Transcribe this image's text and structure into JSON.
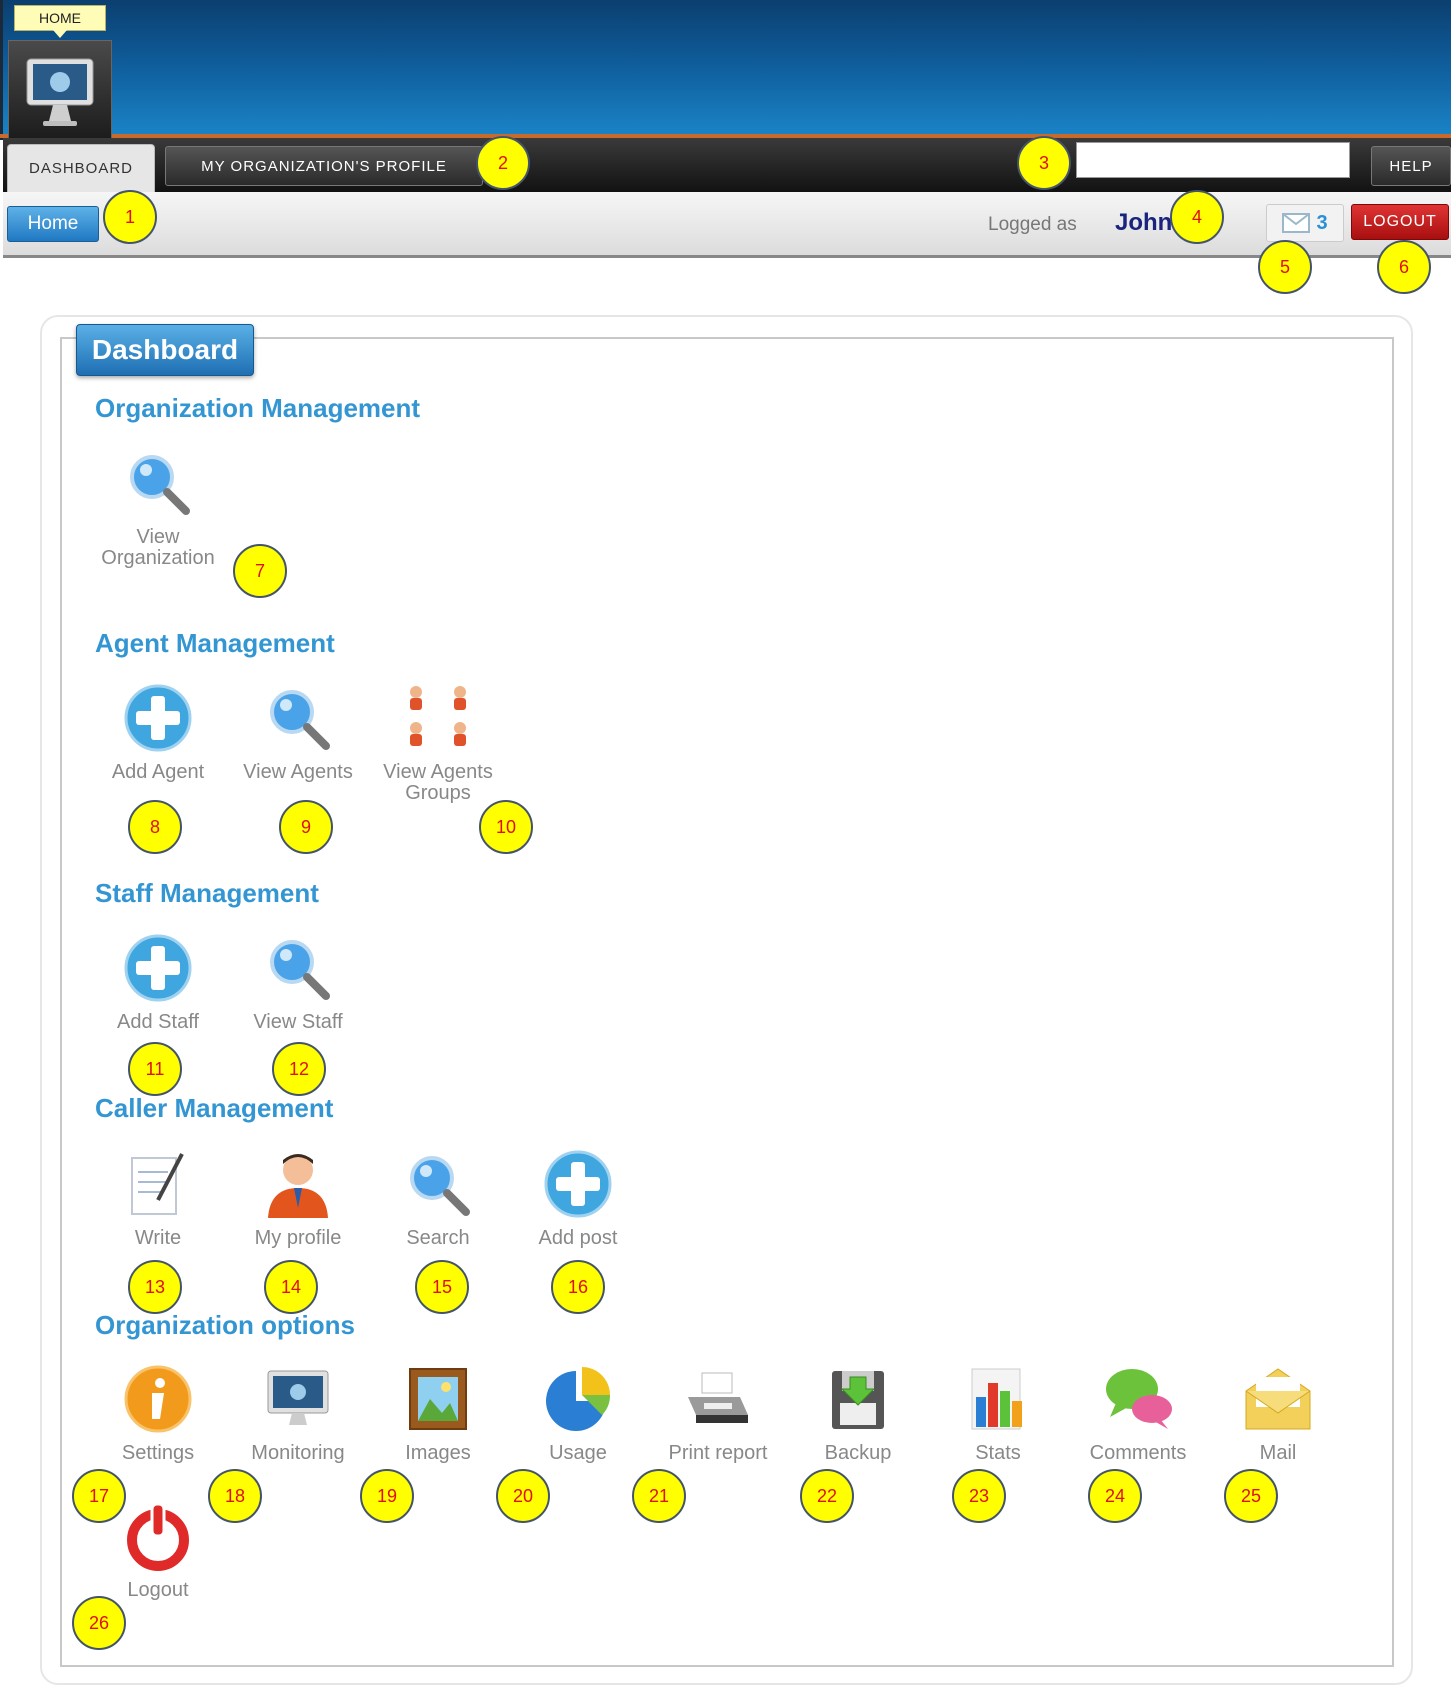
{
  "header": {
    "home_tooltip": "HOME"
  },
  "nav": {
    "dashboard_tab": "DASHBOARD",
    "profile_tab": "MY ORGANIZATION'S PROFILE",
    "search_value": "",
    "help_button": "HELP"
  },
  "subbar": {
    "home_button": "Home",
    "logged_as_label": "Logged as",
    "user_name": "John",
    "mail_count": "3",
    "logout_button": "LOGOUT"
  },
  "dashboard": {
    "title": "Dashboard",
    "sections": {
      "organization": {
        "title": "Organization Management",
        "items": [
          {
            "label_line1": "View",
            "label_line2": "Organization",
            "icon": "magnifier-icon"
          }
        ]
      },
      "agent": {
        "title": "Agent Management",
        "items": [
          {
            "label": "Add Agent",
            "icon": "add-plus-icon"
          },
          {
            "label": "View Agents",
            "icon": "magnifier-icon"
          },
          {
            "label_line1": "View Agents",
            "label_line2": "Groups",
            "icon": "user-group-icon"
          }
        ]
      },
      "staff": {
        "title": "Staff Management",
        "items": [
          {
            "label": "Add Staff",
            "icon": "add-plus-icon"
          },
          {
            "label": "View Staff",
            "icon": "magnifier-icon"
          }
        ]
      },
      "caller": {
        "title": "Caller Management",
        "items": [
          {
            "label": "Write",
            "icon": "pen-paper-icon"
          },
          {
            "label": "My profile",
            "icon": "person-icon"
          },
          {
            "label": "Search",
            "icon": "magnifier-icon"
          },
          {
            "label": "Add post",
            "icon": "add-plus-icon"
          }
        ]
      },
      "options": {
        "title": "Organization options",
        "items": [
          {
            "label": "Settings",
            "icon": "info-icon"
          },
          {
            "label": "Monitoring",
            "icon": "monitor-icon"
          },
          {
            "label": "Images",
            "icon": "picture-frame-icon"
          },
          {
            "label": "Usage",
            "icon": "pie-chart-icon"
          },
          {
            "label": "Print report",
            "icon": "printer-icon"
          },
          {
            "label": "Backup",
            "icon": "floppy-disk-icon"
          },
          {
            "label": "Stats",
            "icon": "bar-chart-icon"
          },
          {
            "label": "Comments",
            "icon": "speech-bubbles-icon"
          },
          {
            "label": "Mail",
            "icon": "envelope-icon"
          },
          {
            "label": "Logout",
            "icon": "power-icon"
          }
        ]
      }
    }
  },
  "markers": [
    "1",
    "2",
    "3",
    "4",
    "5",
    "6",
    "7",
    "8",
    "9",
    "10",
    "11",
    "12",
    "13",
    "14",
    "15",
    "16",
    "17",
    "18",
    "19",
    "20",
    "21",
    "22",
    "23",
    "24",
    "25",
    "26"
  ],
  "colors": {
    "header_blue": "#0f5c9a",
    "section_title_blue": "#3396d3",
    "logout_red": "#c01818",
    "marker_yellow": "#ffff00",
    "marker_text_red": "#e01010"
  }
}
